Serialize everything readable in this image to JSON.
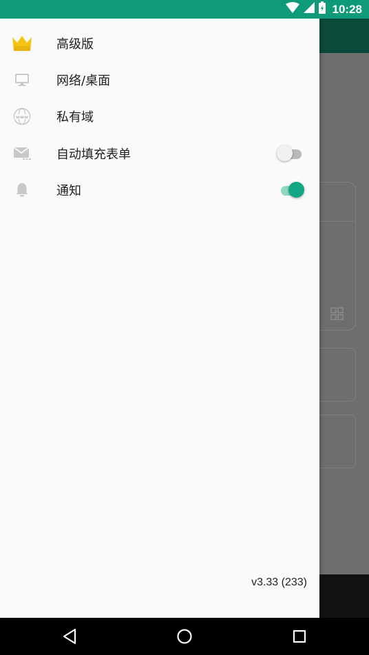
{
  "status_bar": {
    "time": "10:28",
    "icons": [
      "wifi-icon",
      "signal-icon",
      "battery-icon"
    ],
    "color": "#0f9a79"
  },
  "drawer": {
    "items": [
      {
        "label": "高级版",
        "icon": "crown-icon"
      },
      {
        "label": "网络/桌面",
        "icon": "monitor-icon"
      },
      {
        "label": "私有域",
        "icon": "www-globe-icon"
      },
      {
        "label": "自动填充表单",
        "icon": "mail-autofill-icon",
        "toggle": false
      },
      {
        "label": "通知",
        "icon": "bell-icon",
        "toggle": true
      }
    ],
    "version": "v3.33 (233)"
  },
  "nav_bar": {
    "buttons": [
      "back-icon",
      "home-icon",
      "recents-icon"
    ]
  },
  "colors": {
    "accent": "#13a683",
    "crown": "#f4c414",
    "drawer_bg": "#fafafa"
  }
}
